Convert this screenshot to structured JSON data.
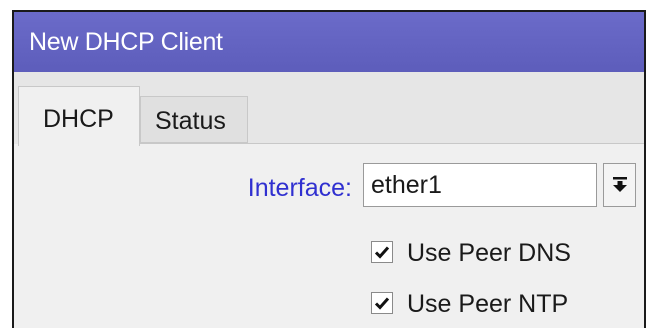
{
  "window": {
    "title": "New DHCP Client"
  },
  "tabs": [
    {
      "label": "DHCP",
      "active": true
    },
    {
      "label": "Status",
      "active": false
    }
  ],
  "form": {
    "interface": {
      "label": "Interface:",
      "value": "ether1"
    },
    "use_peer_dns": {
      "label": "Use Peer DNS",
      "checked": true
    },
    "use_peer_ntp": {
      "label": "Use Peer NTP",
      "checked": true
    }
  },
  "colors": {
    "titlebar": "#6464c3",
    "label_accent": "#3030d0"
  },
  "icons": {
    "dropdown": "dropdown-arrow-icon",
    "check": "checkmark-icon"
  }
}
